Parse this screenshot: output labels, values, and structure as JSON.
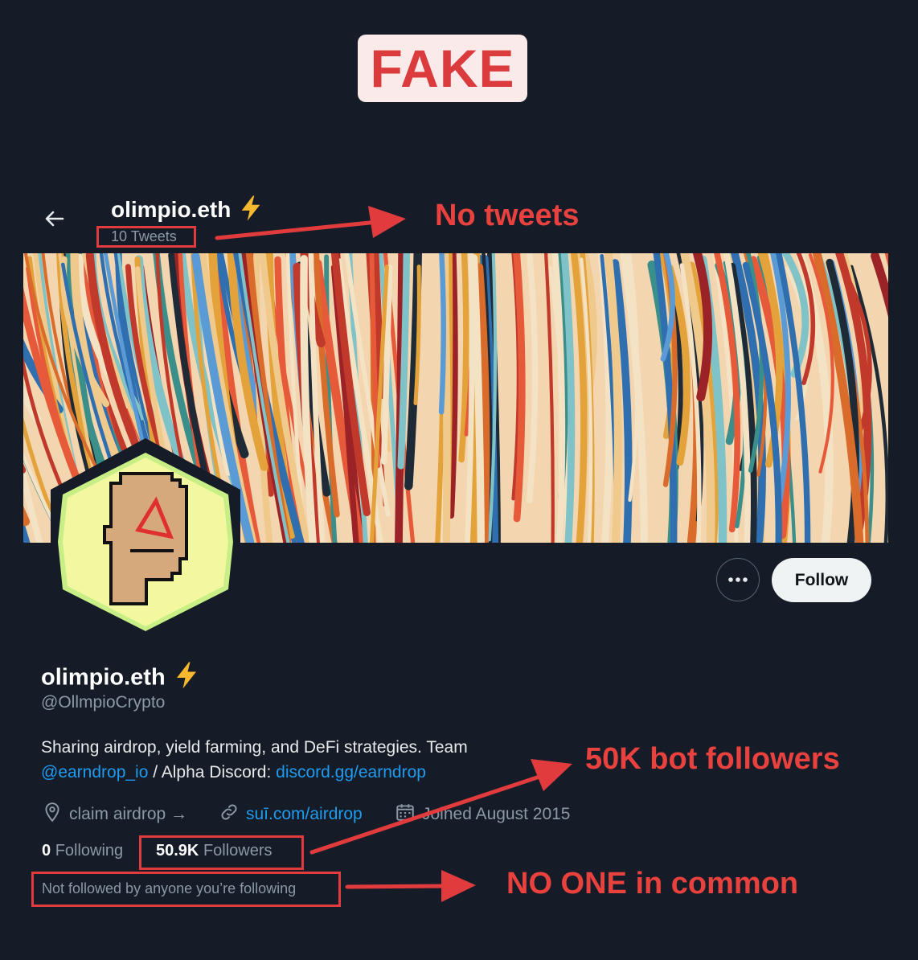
{
  "badge": "FAKE",
  "header": {
    "name": "olimpio.eth",
    "tweets": "10 Tweets"
  },
  "profile": {
    "name": "olimpio.eth",
    "handle": "@OllmpioCrypto",
    "bio_line1": "Sharing airdrop, yield farming, and DeFi strategies. Team",
    "bio_mention": "@earndrop_io",
    "bio_mid": " / Alpha Discord: ",
    "bio_link": "discord.gg/earndrop",
    "location": "claim airdrop →",
    "website": "suī.com/airdrop",
    "joined": "Joined August 2015",
    "following_count": "0",
    "following_label": "Following",
    "followers_count": "50.9K",
    "followers_label": "Followers",
    "not_followed": "Not followed by anyone you’re following"
  },
  "buttons": {
    "follow": "Follow"
  },
  "annotations": {
    "no_tweets": "No tweets",
    "bot_followers": "50K bot followers",
    "no_one_common": "NO ONE in common"
  },
  "colors": {
    "annotation": "#e8413e",
    "background": "#161c27",
    "link": "#1d9bf0",
    "avatar_bg": "#f2f7a0"
  },
  "icons": [
    "back-arrow-icon",
    "lightning-bolt-icon",
    "more-icon",
    "location-icon",
    "link-icon",
    "calendar-icon"
  ]
}
